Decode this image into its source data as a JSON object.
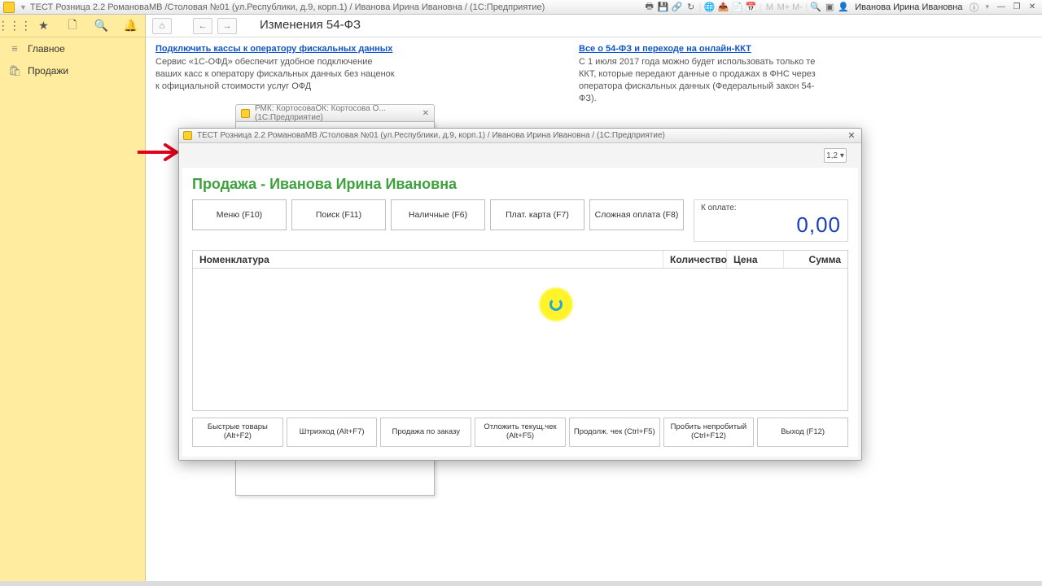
{
  "titlebar": {
    "title": "ТЕСТ Розница 2.2 РомановаМВ /Столовая №01 (ул.Республики, д.9, корп.1) / Иванова Ирина Ивановна /  (1С:Предприятие)",
    "user": "Иванова Ирина Ивановна"
  },
  "sidebar": {
    "items": [
      {
        "icon": "≡",
        "label": "Главное"
      },
      {
        "icon": "🛍",
        "label": "Продажи"
      }
    ]
  },
  "page": {
    "headline": "Изменения 54-ФЗ",
    "left_link": "Подключить кассы к оператору фискальных данных",
    "left_text": "Сервис «1С-ОФД» обеспечит удобное подключение ваших касс к оператору фискальных данных без наценок к официальной стоимости услуг ОФД",
    "right_link": "Все о 54-ФЗ и переходе на онлайн-ККТ",
    "right_text": "С 1 июля 2017 года можно будет использовать только те ККТ, которые передают данные о продажах в ФНС через оператора фискальных данных (Федеральный закон 54-ФЗ)."
  },
  "bg_tab": "РМК: КортосоваОК: Кортосова О... (1С:Предприятие)",
  "dialog": {
    "title": "ТЕСТ Розница 2.2 РомановаМВ /Столовая №01 (ул.Республики, д.9, корп.1) / Иванова Ирина Ивановна /  (1С:Предприятие)",
    "heading": "Продажа - Иванова Ирина Ивановна",
    "selector": "1,2 ▾",
    "buttons_top": [
      "Меню (F10)",
      "Поиск (F11)",
      "Наличные (F6)",
      "Плат. карта (F7)",
      "Сложная оплата (F8)"
    ],
    "total_label": "К оплате:",
    "total_value": "0,00",
    "columns": [
      "Номенклатура",
      "Количество",
      "Цена",
      "Сумма"
    ],
    "buttons_bottom": [
      "Быстрые товары (Alt+F2)",
      "Штрихкод (Alt+F7)",
      "Продажа по заказу",
      "Отложить текущ.чек (Alt+F5)",
      "Продолж. чек (Ctrl+F5)",
      "Пробить непробитый (Ctrl+F12)",
      "Выход (F12)"
    ]
  }
}
